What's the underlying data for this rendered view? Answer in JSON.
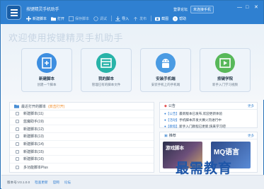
{
  "app": {
    "title": "按键精灵手机助手"
  },
  "toolbar": [
    {
      "label": "新建脚本",
      "icon": "plus-icon"
    },
    {
      "label": "打开",
      "icon": "folder-icon"
    },
    {
      "label": "保存脚本",
      "icon": "save-icon"
    },
    {
      "label": "调试",
      "icon": "debug-icon"
    },
    {
      "label": "导入",
      "icon": "import-icon"
    },
    {
      "label": "发布",
      "icon": "publish-icon"
    },
    {
      "label": "截图",
      "icon": "camera-icon"
    },
    {
      "label": "帮助",
      "icon": "help-icon"
    }
  ],
  "topright": {
    "login": "登录论坛",
    "connect": "未连接手机"
  },
  "hero": {
    "title": "欢迎使用按键精灵手机助手"
  },
  "cards": [
    {
      "title": "新建脚本",
      "sub": "创建一个脚本",
      "color": "#3d8ee0",
      "icon": "new-script-icon"
    },
    {
      "title": "我的脚本",
      "sub": "管理已有的脚本文件",
      "color": "#28b3a8",
      "icon": "my-script-icon"
    },
    {
      "title": "安装手机端",
      "sub": "安装手机上的手机端",
      "color": "#4a9be3",
      "icon": "android-icon"
    },
    {
      "title": "按键学院",
      "sub": "新手入门学习视频",
      "color": "#58b85a",
      "icon": "video-icon"
    }
  ],
  "recent": {
    "title": "最近打开的脚本",
    "hint": "(双击打开)",
    "items": [
      "新建脚本(11)",
      "蓝魔助手(19)",
      "新建脚本(12)",
      "新建脚本(13)",
      "新建脚本(14)",
      "新建脚本(15)",
      "新建脚本(16)",
      "多功能脚本Plus"
    ]
  },
  "news": {
    "title": "公告",
    "more": "更多",
    "items": [
      {
        "prefix": "●【公告】",
        "text": "最新版本已发布,欢迎更新体验"
      },
      {
        "prefix": "●【活动】",
        "text": "手机脚本开发大赛火热进行中"
      },
      {
        "prefix": "●【教程】",
        "text": "新手入门教程已更新,快来学习吧"
      }
    ]
  },
  "media": {
    "title": "推荐",
    "more": "更多",
    "items": [
      "游戏脚本",
      "MQ语言"
    ]
  },
  "status": {
    "version": "版本号:V3.1.0.0",
    "links": [
      "检查更新",
      "官网",
      "论坛"
    ]
  },
  "watermark": "最需教育"
}
